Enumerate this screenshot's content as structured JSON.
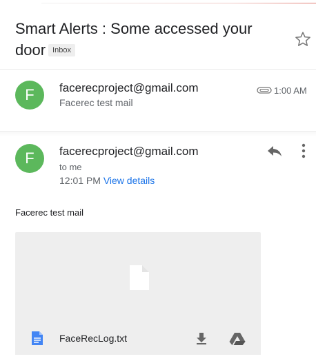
{
  "subject": {
    "text": "Smart Alerts : Some accessed your door",
    "label": "Inbox"
  },
  "messages": [
    {
      "avatar_letter": "F",
      "sender": "facerecproject@gmail.com",
      "snippet": "Facerec test mail",
      "time": "1:00 AM"
    },
    {
      "avatar_letter": "F",
      "sender": "facerecproject@gmail.com",
      "recipient": "to me",
      "time": "12:01 PM",
      "view_details": "View details",
      "body": "Facerec test mail"
    }
  ],
  "attachment": {
    "filename": "FaceRecLog.txt"
  },
  "colors": {
    "avatar": "#5cb85c",
    "link": "#1a73e8",
    "doc_icon": "#4285f4"
  },
  "icons": [
    "star-icon",
    "paperclip-icon",
    "reply-icon",
    "more-vert-icon",
    "file-icon",
    "doc-icon",
    "download-icon",
    "drive-icon"
  ]
}
